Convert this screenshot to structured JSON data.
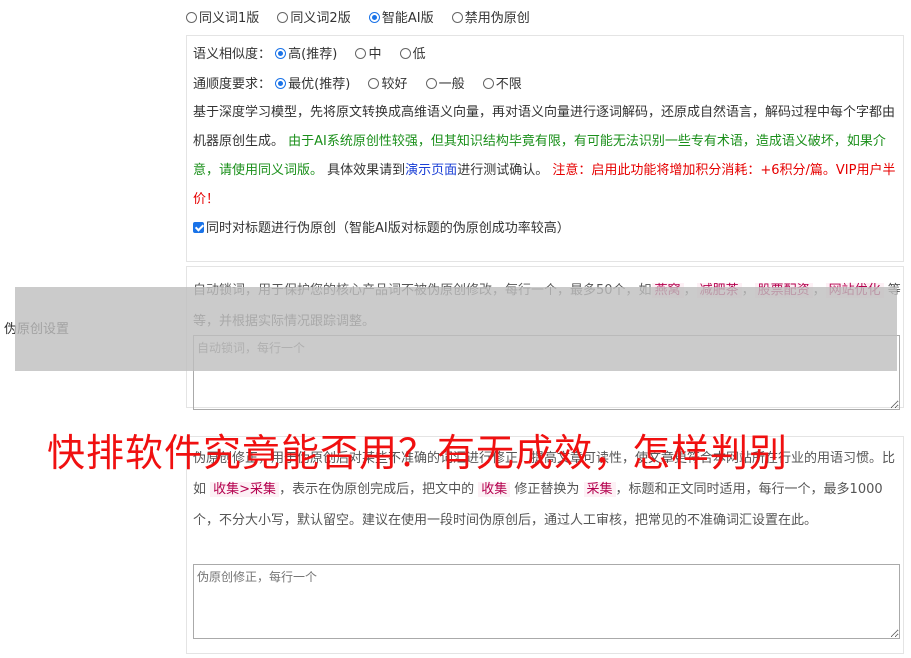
{
  "mode_options": [
    {
      "label": "同义词1版",
      "checked": false
    },
    {
      "label": "同义词2版",
      "checked": false
    },
    {
      "label": "智能AI版",
      "checked": true
    },
    {
      "label": "禁用伪原创",
      "checked": false
    }
  ],
  "settings_label": "伪原创设置",
  "ai_panel": {
    "similarity": {
      "label": "语义相似度：",
      "options": [
        {
          "label": "高(推荐)",
          "checked": true
        },
        {
          "label": "中",
          "checked": false
        },
        {
          "label": "低",
          "checked": false
        }
      ]
    },
    "fluency": {
      "label": "通顺度要求：",
      "options": [
        {
          "label": "最优(推荐)",
          "checked": true
        },
        {
          "label": "较好",
          "checked": false
        },
        {
          "label": "一般",
          "checked": false
        },
        {
          "label": "不限",
          "checked": false
        }
      ]
    },
    "desc_normal": "基于深度学习模型，先将原文转换成高维语义向量，再对语义向量进行逐词解码，还原成自然语言，解码过程中每个字都由机器原创生成。",
    "desc_green": "由于AI系统原创性较强，但其知识结构毕竟有限，有可能无法识别一些专有术语，造成语义破坏，如果介意，请使用同义词版。",
    "desc_before_link": "具体效果请到",
    "desc_link": "演示页面",
    "desc_after_link": "进行测试确认。",
    "desc_red": "注意：启用此功能将增加积分消耗：+6积分/篇。VIP用户半价！",
    "title_checkbox": {
      "label": "同时对标题进行伪原创（智能AI版对标题的伪原创成功率较高）",
      "checked": true
    }
  },
  "lock_panel": {
    "text_before": "自动锁词，用于保护您的核心产品词不被伪原创修改，每行一个，最多50个，如",
    "examples": [
      "燕窝",
      "减肥茶",
      "股票配资",
      "网站优化"
    ],
    "text_after": "等等，并根据实际情况跟踪调整。",
    "placeholder": "自动锁词，每行一个"
  },
  "fix_panel": {
    "text_start": "伪原创修正，用于伪原创后对某些不准确的词汇进行修正，提高文章可读性，使文章更符合本网站所在行业的用语习惯。比如",
    "example_pair": "收集>采集",
    "text_mid1": "，表示在伪原创完成后，把文中的",
    "example_from": "收集",
    "text_mid2": "修正替换为",
    "example_to": "采集",
    "text_end": "，标题和正文同时适用，每行一个，最多1000个，不分大小写，默认留空。建议在使用一段时间伪原创后，通过人工审核，把常见的不准确词汇设置在此。",
    "placeholder": "伪原创修正，每行一个"
  },
  "headline": "快排软件究竟能否用？有无成效，怎样判别"
}
